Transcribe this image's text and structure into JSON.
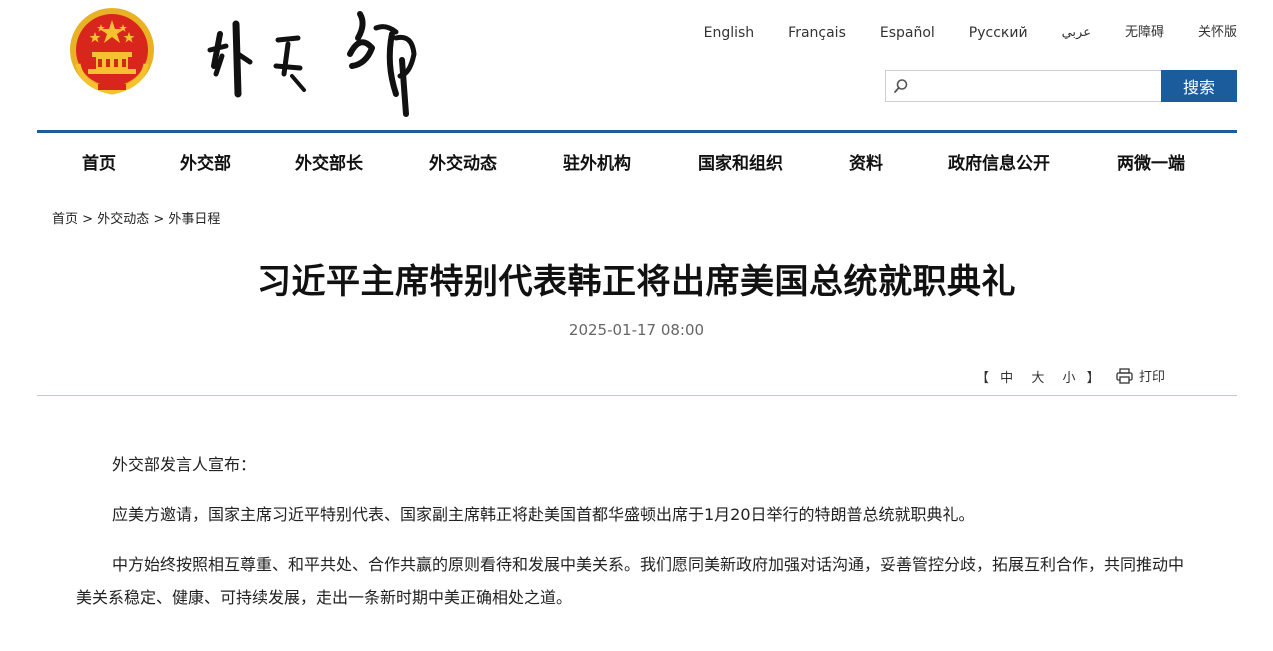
{
  "header": {
    "languages": [
      "English",
      "Français",
      "Español",
      "Русский",
      "عربي",
      "无障碍",
      "关怀版"
    ],
    "search_placeholder": "",
    "search_button": "搜索"
  },
  "nav": {
    "items": [
      "首页",
      "外交部",
      "外交部长",
      "外交动态",
      "驻外机构",
      "国家和组织",
      "资料",
      "政府信息公开",
      "两微一端"
    ]
  },
  "breadcrumb": {
    "items": [
      "首页",
      "外交动态",
      "外事日程"
    ],
    "separator": ">"
  },
  "article": {
    "title": "习近平主席特别代表韩正将出席美国总统就职典礼",
    "date": "2025-01-17 08:00",
    "font_controls": {
      "open": "【",
      "medium": "中",
      "large": "大",
      "small": "小",
      "close": "】"
    },
    "print_label": "打印",
    "paragraphs": [
      "外交部发言人宣布：",
      "应美方邀请，国家主席习近平特别代表、国家副主席韩正将赴美国首都华盛顿出席于1月20日举行的特朗普总统就职典礼。",
      "中方始终按照相互尊重、和平共处、合作共赢的原则看待和发展中美关系。我们愿同美新政府加强对话沟通，妥善管控分歧，拓展互利合作，共同推动中美关系稳定、健康、可持续发展，走出一条新时期中美正确相处之道。"
    ]
  },
  "colors": {
    "primary_blue": "#1b5c9c",
    "divider_teal": "#a9d3d7",
    "emblem_red": "#d8261c",
    "emblem_gold": "#f5c12e"
  }
}
